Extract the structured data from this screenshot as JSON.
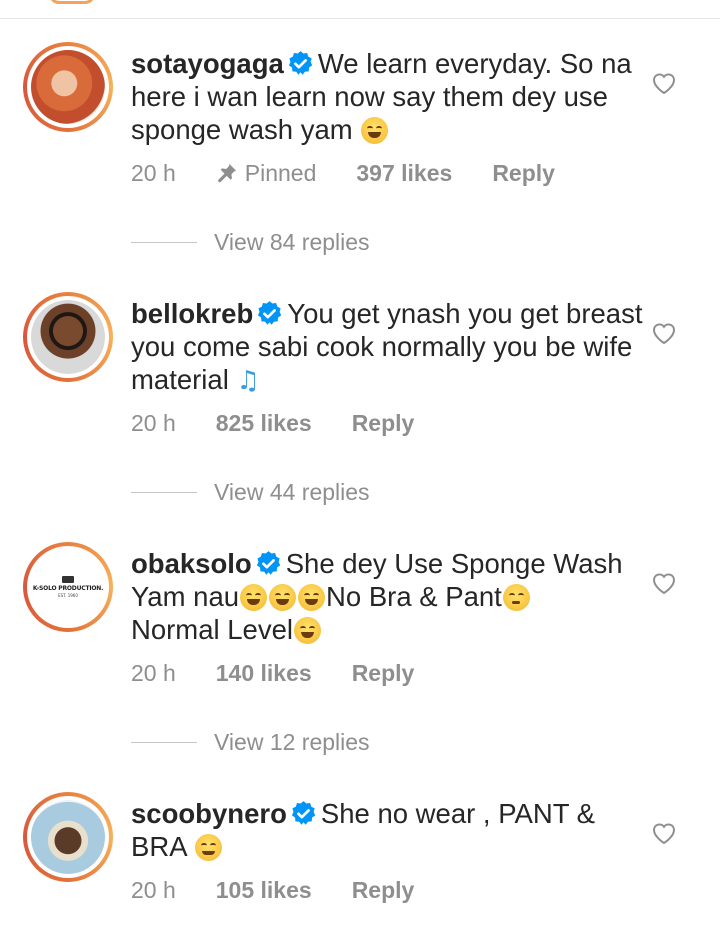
{
  "comments": [
    {
      "username": "sotayogaga",
      "text_parts": [
        "We learn everyday.  So na here i wan learn now say them dey use sponge wash yam"
      ],
      "time": "20 h",
      "pinned_label": "Pinned",
      "likes": "397 likes",
      "reply_label": "Reply",
      "view_replies": "View 84 replies",
      "avatar_icon": "person-photo"
    },
    {
      "username": "bellokreb",
      "text_parts": [
        "You get ynash you get breast you come sabi cook normally you be wife material"
      ],
      "time": "20 h",
      "likes": "825 likes",
      "reply_label": "Reply",
      "view_replies": "View 44 replies",
      "avatar_icon": "person-photo"
    },
    {
      "username": "obaksolo",
      "text_parts": [
        "She dey Use Sponge Wash Yam nau",
        "No Bra & Pant",
        "Normal Level"
      ],
      "avatar_text": "K-SOLO PRODUCTION.",
      "avatar_subtext": "EST. 1960",
      "time": "20 h",
      "likes": "140 likes",
      "reply_label": "Reply",
      "view_replies": "View 12 replies",
      "avatar_icon": "logo"
    },
    {
      "username": "scoobynero",
      "text_parts": [
        "She no wear , PANT & BRA"
      ],
      "time": "20 h",
      "likes": "105 likes",
      "reply_label": "Reply",
      "avatar_icon": "person-photo"
    }
  ],
  "colors": {
    "text": "#262626",
    "secondary": "#8e8e8e",
    "verified": "#0095f6",
    "ring": "#e88240"
  }
}
